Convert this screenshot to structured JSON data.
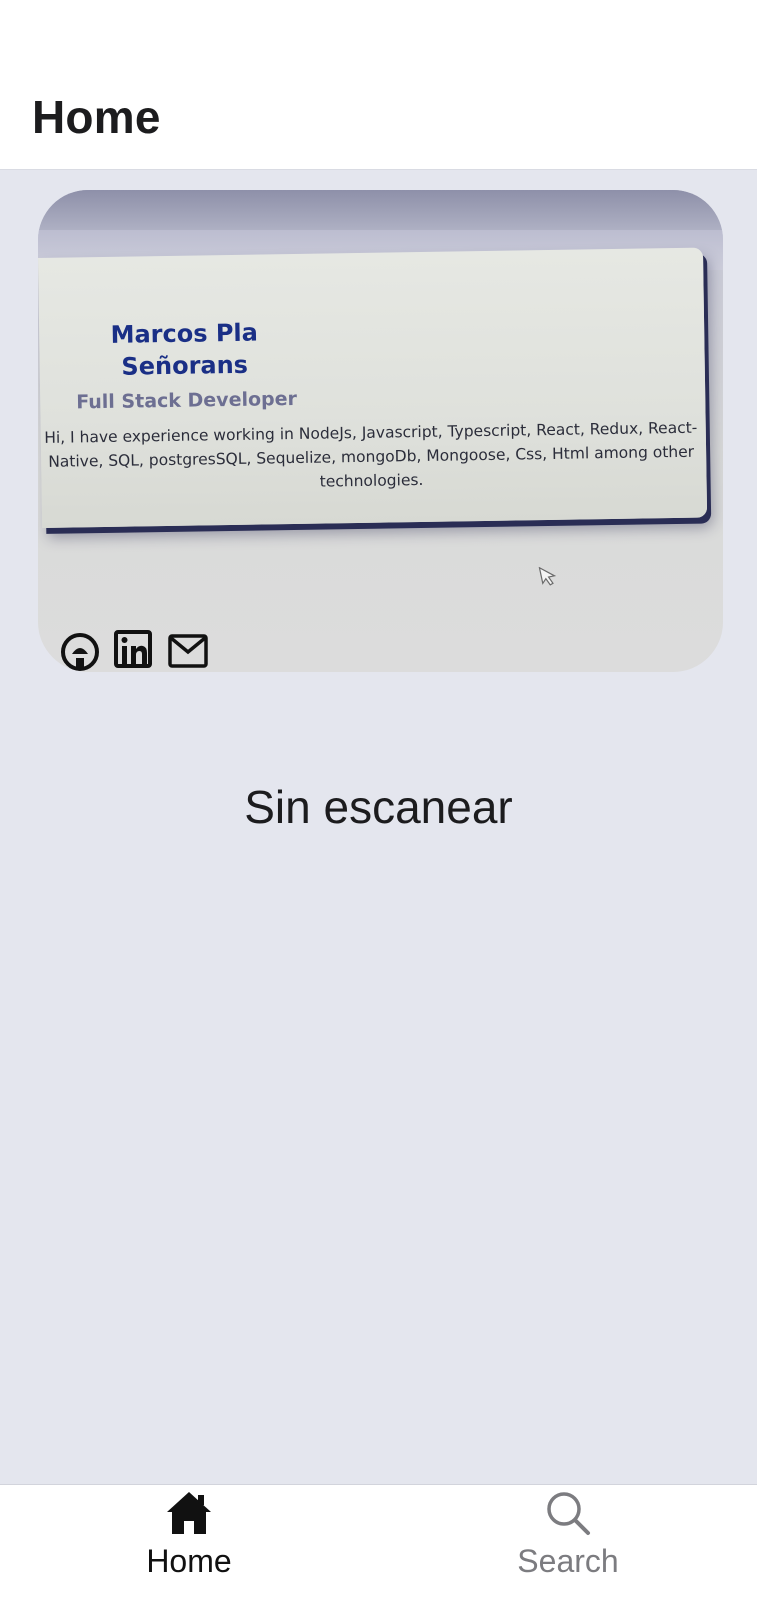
{
  "header": {
    "title": "Home"
  },
  "camera_preview": {
    "card": {
      "name": "Marcos Pla Señorans",
      "role": "Full Stack Developer",
      "bio": "Hi, I have experience working in NodeJs, Javascript, Typescript, React, Redux, React-Native, SQL, postgresSQL, Sequelize, mongoDb, Mongoose, Css, Html among other technologies."
    },
    "social_icons": [
      "github-icon",
      "linkedin-icon",
      "mail-icon"
    ]
  },
  "scan_status": "Sin escanear",
  "tabbar": {
    "tabs": [
      {
        "label": "Home",
        "icon": "home-icon",
        "active": true
      },
      {
        "label": "Search",
        "icon": "search-icon",
        "active": false
      }
    ],
    "active_color": "#111111",
    "inactive_color": "#7c7c80"
  },
  "colors": {
    "background": "#e4e6ee",
    "header": "#ffffff",
    "card_name": "#1a2f86"
  }
}
